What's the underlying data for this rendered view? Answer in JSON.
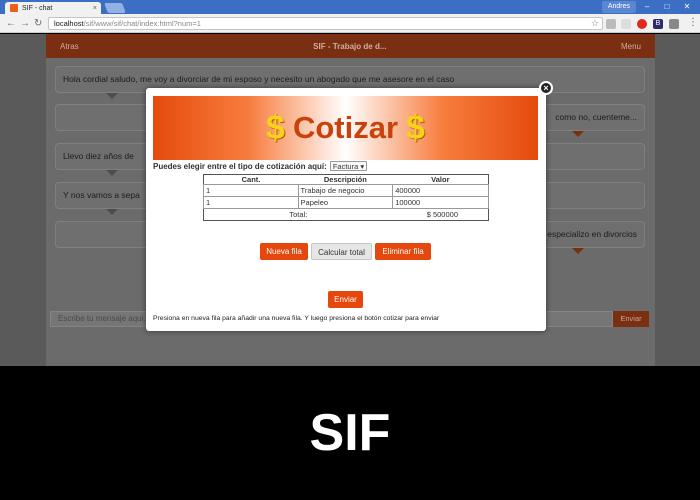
{
  "browser": {
    "tab_title": "SIF - chat",
    "tab_close": "×",
    "user_name": "Andres",
    "url_host": "localhost",
    "url_path": "/sif/www/sif/chat/index.html?num=1",
    "extensions": [
      "opera-icon",
      "b-icon",
      "menu-icon"
    ],
    "ext_b_label": "B"
  },
  "chat": {
    "back_label": "Atras",
    "title": "SIF - Trabajo de d...",
    "menu_label": "Menu",
    "messages": [
      {
        "text": "Hola cordial saludo, me voy a divorciar de mi esposo y necesito un abogado que me asesore en el caso",
        "side": "left"
      },
      {
        "text": "como no, cuenteme...",
        "side": "right"
      },
      {
        "text": "Llevo diez años de",
        "side": "left"
      },
      {
        "text": "Y nos vamos a sepa",
        "side": "left"
      },
      {
        "text": "especializo en divorcios",
        "side": "right"
      }
    ],
    "compose_placeholder": "Escribe tu mensaje aqui...",
    "send_label": "Enviar"
  },
  "modal": {
    "close": "×",
    "banner_title": "Cotizar",
    "banner_symbol": "$",
    "type_label": "Puedes elegir entre el tipo de cotización aquí:",
    "type_selected": "Factura",
    "columns": [
      "Cant.",
      "Descripción",
      "Valor"
    ],
    "rows": [
      {
        "qty": "1",
        "desc": "Trabajo de negocio",
        "value": "400000"
      },
      {
        "qty": "1",
        "desc": "Papeleo",
        "value": "100000"
      }
    ],
    "total_label": "Total:",
    "total_value": "$ 500000",
    "buttons": {
      "new_row": "Nueva fila",
      "calc_total": "Calcular total",
      "delete_row": "Eliminar fila",
      "send": "Enviar"
    },
    "hint": "Presiona en nueva fila para añadir una nueva fila. Y luego presiona el botón cotizar para enviar"
  },
  "caption": "SIF",
  "colors": {
    "accent": "#e5470c",
    "chrome_blue": "#3c6fc4",
    "overlay_header": "#7a2e12"
  }
}
